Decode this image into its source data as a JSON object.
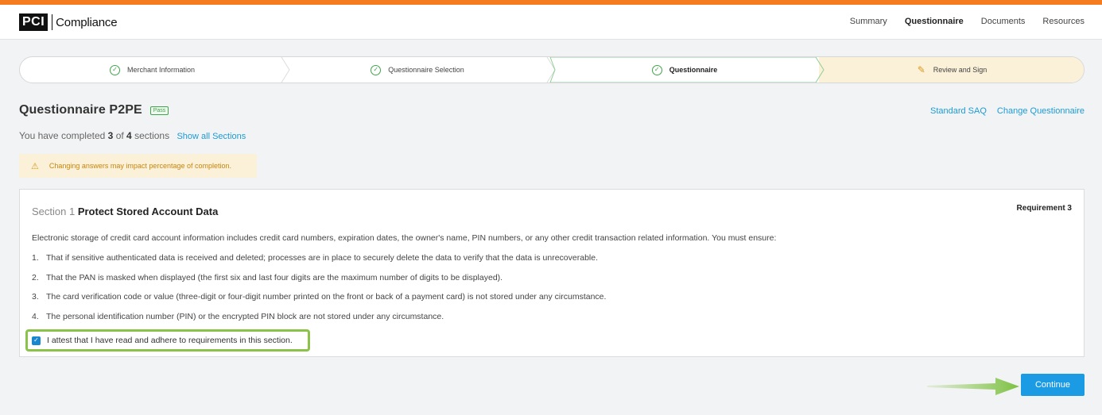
{
  "brand": {
    "logo_mark": "PCI",
    "logo_text": "Compliance",
    "accent_color": "#f47b20"
  },
  "nav": {
    "items": [
      {
        "label": "Summary"
      },
      {
        "label": "Questionnaire",
        "active": true
      },
      {
        "label": "Documents"
      },
      {
        "label": "Resources"
      }
    ]
  },
  "stepper": {
    "steps": [
      {
        "label": "Merchant Information",
        "status": "complete",
        "icon": "check-circle-icon"
      },
      {
        "label": "Questionnaire Selection",
        "status": "complete",
        "icon": "check-circle-icon"
      },
      {
        "label": "Questionnaire",
        "status": "current",
        "icon": "check-circle-icon"
      },
      {
        "label": "Review and Sign",
        "status": "pending",
        "icon": "edit-document-icon"
      }
    ]
  },
  "page": {
    "title": "Questionnaire P2PE",
    "badge": "Pass",
    "links": {
      "standard_saq": "Standard SAQ",
      "change_questionnaire": "Change Questionnaire"
    }
  },
  "progress": {
    "prefix": "You have completed",
    "completed": "3",
    "of": "of",
    "total": "4",
    "suffix": "sections",
    "show_all": "Show all Sections"
  },
  "warning": {
    "text": "Changing answers may impact percentage of completion.",
    "icon": "warning-triangle-icon"
  },
  "section": {
    "number_label": "Section 1",
    "title": "Protect Stored Account Data",
    "requirement": "Requirement 3",
    "intro": "Electronic storage of credit card account information includes credit card numbers, expiration dates, the owner's name, PIN numbers, or any other credit transaction related information. You must ensure:",
    "items": [
      {
        "num": "1.",
        "text": "That if sensitive authenticated data is received and deleted; processes are in place to securely delete the data to verify that the data is unrecoverable."
      },
      {
        "num": "2.",
        "text": "That the PAN is masked when displayed (the first six and last four digits are the maximum number of digits to be displayed)."
      },
      {
        "num": "3.",
        "text": "The card verification code or value (three-digit or four-digit number printed on the front or back of a payment card) is not stored under any circumstance."
      },
      {
        "num": "4.",
        "text": "The personal identification number (PIN) or the encrypted PIN block are not stored under any circumstance."
      }
    ],
    "attest_label": "I attest that I have read and adhere to requirements in this section.",
    "attest_checked": true
  },
  "actions": {
    "continue_label": "Continue"
  },
  "colors": {
    "primary": "#1a9be4",
    "success": "#3fa54a",
    "warning_bg": "#fbf0d8",
    "warning_text": "#c8860e",
    "highlight": "#8bc34a"
  }
}
